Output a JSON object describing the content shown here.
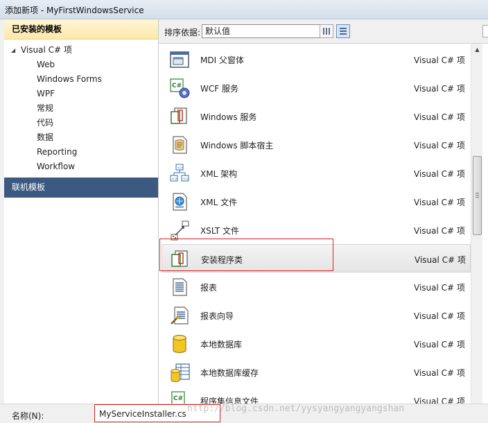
{
  "window": {
    "title": "添加新项 - MyFirstWindowsService"
  },
  "left_pane": {
    "installed_header": "已安装的模板",
    "tree_root": "Visual C# 项",
    "tree_children": [
      "Web",
      "Windows Forms",
      "WPF",
      "常规",
      "代码",
      "数据",
      "Reporting",
      "Workflow"
    ],
    "online_header": "联机模板"
  },
  "toolbar": {
    "sort_label": "排序依据:",
    "sort_value": "默认值"
  },
  "items": [
    {
      "name": "MDI 父窗体",
      "type": "Visual C# 项",
      "icon": "mdi-form-icon"
    },
    {
      "name": "WCF 服务",
      "type": "Visual C# 项",
      "icon": "wcf-service-icon"
    },
    {
      "name": "Windows 服务",
      "type": "Visual C# 项",
      "icon": "windows-service-icon"
    },
    {
      "name": "Windows 脚本宿主",
      "type": "Visual C# 项",
      "icon": "script-host-icon"
    },
    {
      "name": "XML 架构",
      "type": "Visual C# 项",
      "icon": "xml-schema-icon"
    },
    {
      "name": "XML 文件",
      "type": "Visual C# 项",
      "icon": "xml-file-icon"
    },
    {
      "name": "XSLT 文件",
      "type": "Visual C# 项",
      "icon": "xslt-file-icon"
    },
    {
      "name": "安装程序类",
      "type": "Visual C# 项",
      "icon": "installer-class-icon",
      "selected": true
    },
    {
      "name": "报表",
      "type": "Visual C# 项",
      "icon": "report-icon"
    },
    {
      "name": "报表向导",
      "type": "Visual C# 项",
      "icon": "report-wizard-icon"
    },
    {
      "name": "本地数据库",
      "type": "Visual C# 项",
      "icon": "local-database-icon"
    },
    {
      "name": "本地数据库缓存",
      "type": "Visual C# 项",
      "icon": "local-database-cache-icon"
    },
    {
      "name": "程序集信息文件",
      "type": "Visual C# 项",
      "icon": "assembly-info-icon"
    }
  ],
  "bottom": {
    "name_label": "名称(N):",
    "name_value": "MyServiceInstaller.cs"
  },
  "watermark": "http://blog.csdn.net/yysyangyangyangshan",
  "colors": {
    "online_header_bg": "#3c5a80",
    "selection_outline": "#d32020",
    "installed_header_bg": "#fde8a8"
  }
}
